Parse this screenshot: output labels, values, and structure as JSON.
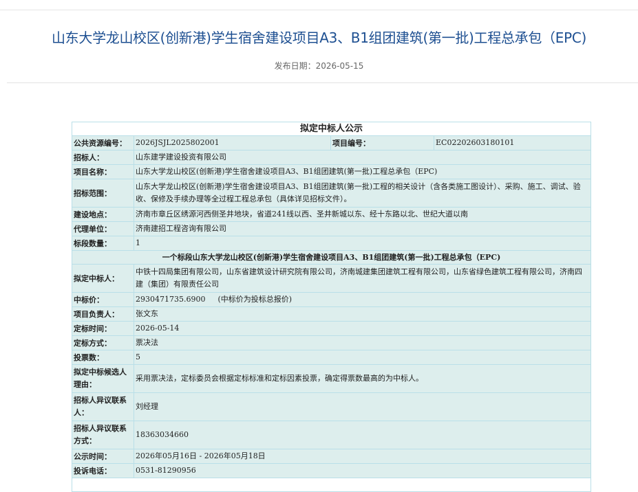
{
  "header": {
    "title": "山东大学龙山校区(创新港)学生宿舍建设项目A3、B1组团建筑(第一批)工程总承包（EPC)",
    "publish_label": "发布日期：",
    "publish_date": "2026-05-15"
  },
  "notice": {
    "heading": "拟定中标人公示",
    "resource_no_label": "公共资源编号：",
    "resource_no": "2026JSJL2025802001",
    "project_no_label": "项目编号：",
    "project_no": "EC02202603180101",
    "tenderer_label": "招标人：",
    "tenderer": "山东建学建设投资有限公司",
    "project_name_label": "项目名称：",
    "project_name": "山东大学龙山校区(创新港)学生宿舍建设项目A3、B1组团建筑(第一批)工程总承包（EPC)",
    "scope_label": "招标范围：",
    "scope": "山东大学龙山校区(创新港)学生宿舍建设项目A3、B1组团建筑(第一批)工程的相关设计（含各类施工图设计）、采购、施工、调试、验收、保修及手续办理等全过程工程总承包（具体详见招标文件）。",
    "location_label": "建设地点：",
    "location": "济南市章丘区绣源河西侧圣井地块，省道241线以西、圣井新城以东、经十东路以北、世纪大道以南",
    "agency_label": "代理单位：",
    "agency": "济南建招工程咨询有限公司",
    "sections_label": "标段数量：",
    "sections": "1",
    "section_title": "一个标段山东大学龙山校区(创新港)学生宿舍建设项目A3、B1组团建筑(第一批)工程总承包（EPC)",
    "winner_label": "拟定中标人：",
    "winner": "中铁十四局集团有限公司，山东省建筑设计研究院有限公司，济南城建集团建筑工程有限公司，山东省绿色建筑工程有限公司，济南四建（集团）有限责任公司",
    "price_label": "中标价：",
    "price": "2930471735.6900",
    "price_note": "(中标价为投标总报价)",
    "manager_label": "项目负责人：",
    "manager": "张文东",
    "award_time_label": "定标时间：",
    "award_time": "2026-05-14",
    "method_label": "定标方式：",
    "method": "票决法",
    "votes_label": "投票数：",
    "votes": "5",
    "reason_label": "拟定中标候选人理由：",
    "reason": "采用票决法，定标委员会根据定标标准和定标因素投票，确定得票数最高的为中标人。",
    "objection_contact_label": "招标人异议联系人：",
    "objection_contact": "刘经理",
    "objection_phone_label": "招标人异议联系方式：",
    "objection_phone": "18363034660",
    "publicity_time_label": "公示时间：",
    "publicity_time": "2026年05月16日 - 2026年05月18日",
    "complaint_phone_label": "投诉电话：",
    "complaint_phone": "0531-81290956"
  }
}
